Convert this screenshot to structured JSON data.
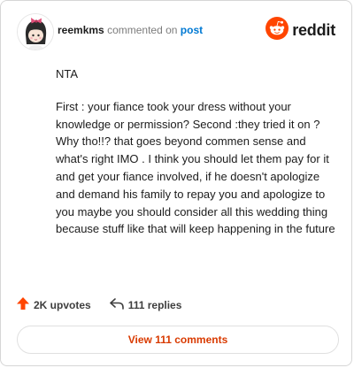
{
  "comment": {
    "username": "reemkms",
    "action_text": "commented on",
    "post_link": "post",
    "paragraphs": [
      "NTA",
      "First : your fiance took your dress without your knowledge or permission? Second :they tried it on ? Why tho!!? that goes beyond commen sense and what's right IMO . I think you should let them pay for it and get your fiance involved, if he doesn't apologize and demand his family to repay you and apologize to you maybe you should consider all this wedding thing because stuff like that will keep happening in the future"
    ]
  },
  "brand": {
    "name": "reddit",
    "icon": "reddit-logo-icon",
    "color": "#ff4500"
  },
  "stats": {
    "upvotes": "2K upvotes",
    "upvote_icon": "upvote-arrow-icon",
    "upvote_color": "#ff4500",
    "replies": "111 replies",
    "reply_icon": "reply-arrow-icon"
  },
  "footer": {
    "view_button": "View 111 comments",
    "accent": "#d93a00"
  }
}
